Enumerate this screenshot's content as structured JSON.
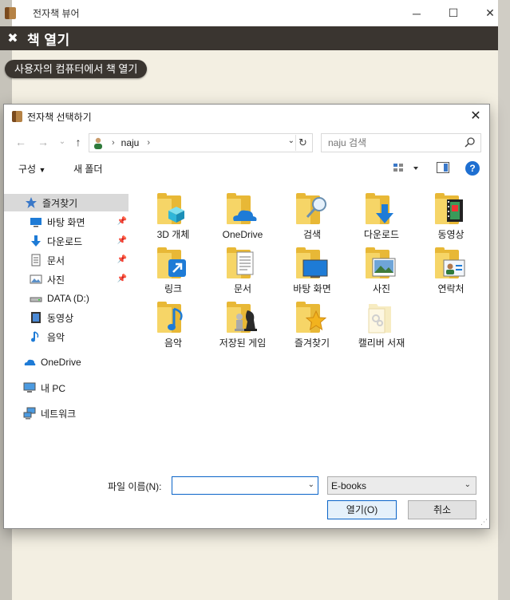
{
  "app": {
    "title": "전자책 뷰어",
    "header_title": "책 열기",
    "open_from_computer": "사용자의 컴퓨터에서 책 열기",
    "window_controls": {
      "minimize": "─",
      "maximize": "☐",
      "close": "✕"
    }
  },
  "dialog": {
    "title": "전자책 선택하기",
    "address_path": "naju",
    "search_placeholder": "naju 검색",
    "toolbar": {
      "organize": "구성",
      "new_folder": "새 폴더"
    },
    "nav": [
      {
        "label": "즐겨찾기",
        "icon": "star-icon",
        "pinned": false
      },
      {
        "label": "바탕 화면",
        "icon": "desktop-icon",
        "pinned": true
      },
      {
        "label": "다운로드",
        "icon": "download-icon",
        "pinned": true
      },
      {
        "label": "문서",
        "icon": "document-icon",
        "pinned": true
      },
      {
        "label": "사진",
        "icon": "pictures-icon",
        "pinned": true
      },
      {
        "label": "DATA (D:)",
        "icon": "drive-icon",
        "pinned": false
      },
      {
        "label": "동영상",
        "icon": "video-icon",
        "pinned": false
      },
      {
        "label": "음악",
        "icon": "music-icon",
        "pinned": false
      },
      {
        "label": "OneDrive",
        "icon": "onedrive-icon",
        "pinned": false
      },
      {
        "label": "내 PC",
        "icon": "pc-icon",
        "pinned": false
      },
      {
        "label": "네트워크",
        "icon": "network-icon",
        "pinned": false
      }
    ],
    "folders": [
      {
        "label": "3D 개체",
        "icon": "3d-objects-folder-icon"
      },
      {
        "label": "OneDrive",
        "icon": "onedrive-folder-icon"
      },
      {
        "label": "검색",
        "icon": "search-folder-icon"
      },
      {
        "label": "다운로드",
        "icon": "downloads-folder-icon"
      },
      {
        "label": "동영상",
        "icon": "videos-folder-icon"
      },
      {
        "label": "링크",
        "icon": "links-folder-icon"
      },
      {
        "label": "문서",
        "icon": "documents-folder-icon"
      },
      {
        "label": "바탕 화면",
        "icon": "desktop-folder-icon"
      },
      {
        "label": "사진",
        "icon": "pictures-folder-icon"
      },
      {
        "label": "연락처",
        "icon": "contacts-folder-icon"
      },
      {
        "label": "음악",
        "icon": "music-folder-icon"
      },
      {
        "label": "저장된 게임",
        "icon": "saved-games-folder-icon"
      },
      {
        "label": "즐겨찾기",
        "icon": "favorites-folder-icon"
      },
      {
        "label": "캘리버 서재",
        "icon": "calibre-library-folder-icon"
      }
    ],
    "file_name_label": "파일 이름(N):",
    "file_name_value": "",
    "file_type": "E-books",
    "open_button": "열기(O)",
    "cancel_button": "취소"
  }
}
